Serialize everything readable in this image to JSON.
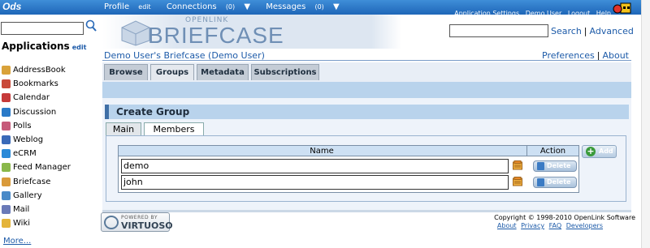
{
  "topbar": {
    "logo": "Ods",
    "profile": "Profile",
    "profile_edit": "edit",
    "connections": "Connections",
    "connections_count": "(0)",
    "messages": "Messages",
    "messages_count": "(0)",
    "links": [
      "Application Settings",
      "Demo User",
      "Logout",
      "Help"
    ]
  },
  "sidebar": {
    "search_value": "",
    "title": "Applications",
    "title_edit": "edit",
    "items": [
      {
        "label": "AddressBook",
        "icon": "addressbook-icon",
        "color": "#d9a23a"
      },
      {
        "label": "Bookmarks",
        "icon": "bookmarks-icon",
        "color": "#c94a3a"
      },
      {
        "label": "Calendar",
        "icon": "calendar-icon",
        "color": "#c63a3a"
      },
      {
        "label": "Discussion",
        "icon": "discussion-icon",
        "color": "#2a7ac8"
      },
      {
        "label": "Polls",
        "icon": "polls-icon",
        "color": "#c65a7a"
      },
      {
        "label": "Weblog",
        "icon": "weblog-icon",
        "color": "#3a6ab8"
      },
      {
        "label": "eCRM",
        "icon": "ecrm-icon",
        "color": "#2a8ad8"
      },
      {
        "label": "Feed Manager",
        "icon": "feed-icon",
        "color": "#8ab84a"
      },
      {
        "label": "Briefcase",
        "icon": "briefcase-icon",
        "color": "#d99a3a"
      },
      {
        "label": "Gallery",
        "icon": "gallery-icon",
        "color": "#4a8ac8"
      },
      {
        "label": "Mail",
        "icon": "mail-icon",
        "color": "#6a7ab8"
      },
      {
        "label": "Wiki",
        "icon": "wiki-icon",
        "color": "#e4b43a"
      }
    ],
    "more": "More..."
  },
  "banner": {
    "small": "OPENLINK",
    "big": "BRIEFCASE"
  },
  "search": {
    "value": "",
    "search_link": "Search",
    "advanced_link": "Advanced"
  },
  "breadcrumb": "Demo User's Briefcase (Demo User)",
  "prefs": {
    "preferences": "Preferences",
    "about": "About"
  },
  "tabs": [
    "Browse",
    "Groups",
    "Metadata",
    "Subscriptions"
  ],
  "active_tab": "Groups",
  "create_group": {
    "title": "Create Group",
    "subtabs": [
      "Main",
      "Members"
    ],
    "active_subtab": "Members",
    "columns": {
      "name": "Name",
      "action": "Action"
    },
    "members": [
      "demo",
      "john"
    ],
    "delete_label": "Delete",
    "add_label": "Add"
  },
  "footer": {
    "powered_by": "POWERED BY",
    "virtuoso": "VIRTUOSO",
    "copyright": "Copyright © 1998-2010 OpenLink Software",
    "links": [
      "About",
      "Privacy",
      "FAQ",
      "Developers"
    ]
  }
}
